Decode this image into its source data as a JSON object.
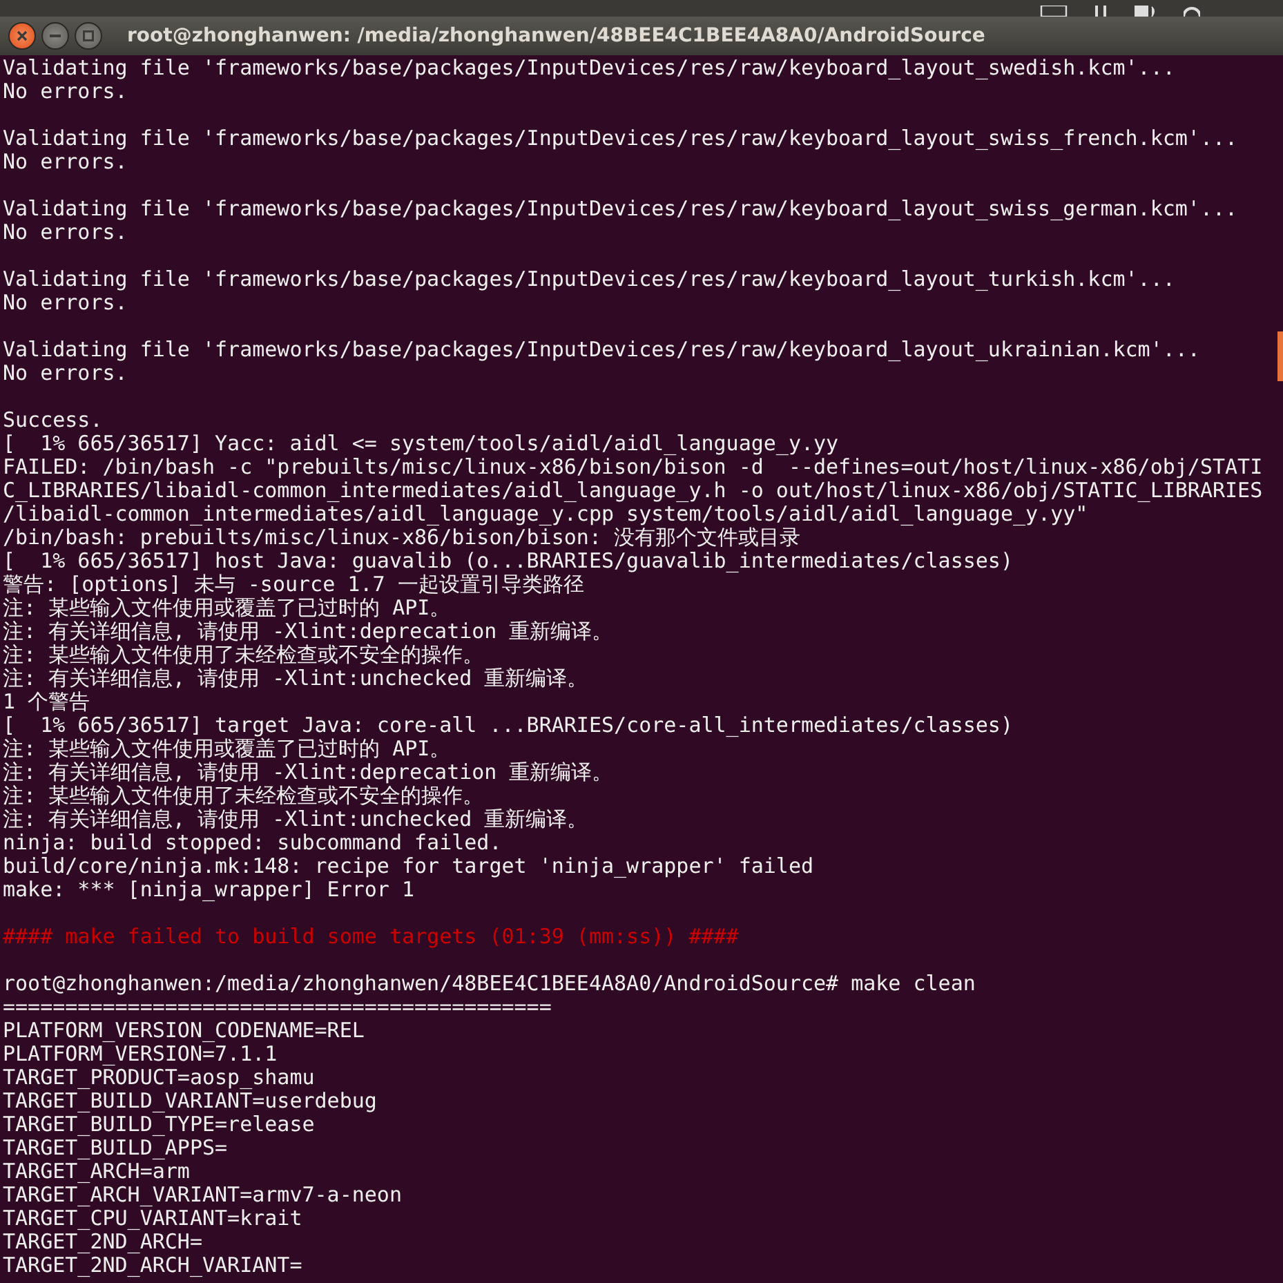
{
  "window": {
    "title": "root@zhonghanwen: /media/zhonghanwen/48BEE4C1BEE4A8A0/AndroidSource"
  },
  "terminal": {
    "lines": [
      {
        "kind": "normal",
        "text": "Validating file 'frameworks/base/packages/InputDevices/res/raw/keyboard_layout_swedish.kcm'..."
      },
      {
        "kind": "normal",
        "text": "No errors."
      },
      {
        "kind": "blank"
      },
      {
        "kind": "normal",
        "text": "Validating file 'frameworks/base/packages/InputDevices/res/raw/keyboard_layout_swiss_french.kcm'..."
      },
      {
        "kind": "normal",
        "text": "No errors."
      },
      {
        "kind": "blank"
      },
      {
        "kind": "normal",
        "text": "Validating file 'frameworks/base/packages/InputDevices/res/raw/keyboard_layout_swiss_german.kcm'..."
      },
      {
        "kind": "normal",
        "text": "No errors."
      },
      {
        "kind": "blank"
      },
      {
        "kind": "normal",
        "text": "Validating file 'frameworks/base/packages/InputDevices/res/raw/keyboard_layout_turkish.kcm'..."
      },
      {
        "kind": "normal",
        "text": "No errors."
      },
      {
        "kind": "blank"
      },
      {
        "kind": "normal",
        "text": "Validating file 'frameworks/base/packages/InputDevices/res/raw/keyboard_layout_ukrainian.kcm'..."
      },
      {
        "kind": "normal",
        "text": "No errors."
      },
      {
        "kind": "blank"
      },
      {
        "kind": "normal",
        "text": "Success."
      },
      {
        "kind": "normal",
        "text": "[  1% 665/36517] Yacc: aidl <= system/tools/aidl/aidl_language_y.yy"
      },
      {
        "kind": "normal",
        "text": "FAILED: /bin/bash -c \"prebuilts/misc/linux-x86/bison/bison -d  --defines=out/host/linux-x86/obj/STATI"
      },
      {
        "kind": "normal",
        "text": "C_LIBRARIES/libaidl-common_intermediates/aidl_language_y.h -o out/host/linux-x86/obj/STATIC_LIBRARIES"
      },
      {
        "kind": "normal",
        "text": "/libaidl-common_intermediates/aidl_language_y.cpp system/tools/aidl/aidl_language_y.yy\""
      },
      {
        "kind": "normal",
        "text": "/bin/bash: prebuilts/misc/linux-x86/bison/bison: 没有那个文件或目录"
      },
      {
        "kind": "normal",
        "text": "[  1% 665/36517] host Java: guavalib (o...BRARIES/guavalib_intermediates/classes)"
      },
      {
        "kind": "normal",
        "text": "警告: [options] 未与 -source 1.7 一起设置引导类路径"
      },
      {
        "kind": "normal",
        "text": "注: 某些输入文件使用或覆盖了已过时的 API。"
      },
      {
        "kind": "normal",
        "text": "注: 有关详细信息, 请使用 -Xlint:deprecation 重新编译。"
      },
      {
        "kind": "normal",
        "text": "注: 某些输入文件使用了未经检查或不安全的操作。"
      },
      {
        "kind": "normal",
        "text": "注: 有关详细信息, 请使用 -Xlint:unchecked 重新编译。"
      },
      {
        "kind": "normal",
        "text": "1 个警告"
      },
      {
        "kind": "normal",
        "text": "[  1% 665/36517] target Java: core-all ...BRARIES/core-all_intermediates/classes)"
      },
      {
        "kind": "normal",
        "text": "注: 某些输入文件使用或覆盖了已过时的 API。"
      },
      {
        "kind": "normal",
        "text": "注: 有关详细信息, 请使用 -Xlint:deprecation 重新编译。"
      },
      {
        "kind": "normal",
        "text": "注: 某些输入文件使用了未经检查或不安全的操作。"
      },
      {
        "kind": "normal",
        "text": "注: 有关详细信息, 请使用 -Xlint:unchecked 重新编译。"
      },
      {
        "kind": "normal",
        "text": "ninja: build stopped: subcommand failed."
      },
      {
        "kind": "normal",
        "text": "build/core/ninja.mk:148: recipe for target 'ninja_wrapper' failed"
      },
      {
        "kind": "normal",
        "text": "make: *** [ninja_wrapper] Error 1"
      },
      {
        "kind": "blank"
      },
      {
        "kind": "error",
        "text": "#### make failed to build some targets (01:39 (mm:ss)) ####"
      },
      {
        "kind": "blank"
      },
      {
        "kind": "normal",
        "text": "root@zhonghanwen:/media/zhonghanwen/48BEE4C1BEE4A8A0/AndroidSource# make clean"
      },
      {
        "kind": "normal",
        "text": "============================================"
      },
      {
        "kind": "normal",
        "text": "PLATFORM_VERSION_CODENAME=REL"
      },
      {
        "kind": "normal",
        "text": "PLATFORM_VERSION=7.1.1"
      },
      {
        "kind": "normal",
        "text": "TARGET_PRODUCT=aosp_shamu"
      },
      {
        "kind": "normal",
        "text": "TARGET_BUILD_VARIANT=userdebug"
      },
      {
        "kind": "normal",
        "text": "TARGET_BUILD_TYPE=release"
      },
      {
        "kind": "normal",
        "text": "TARGET_BUILD_APPS="
      },
      {
        "kind": "normal",
        "text": "TARGET_ARCH=arm"
      },
      {
        "kind": "normal",
        "text": "TARGET_ARCH_VARIANT=armv7-a-neon"
      },
      {
        "kind": "normal",
        "text": "TARGET_CPU_VARIANT=krait"
      },
      {
        "kind": "normal",
        "text": "TARGET_2ND_ARCH="
      },
      {
        "kind": "normal",
        "text": "TARGET_2ND_ARCH_VARIANT="
      }
    ]
  }
}
